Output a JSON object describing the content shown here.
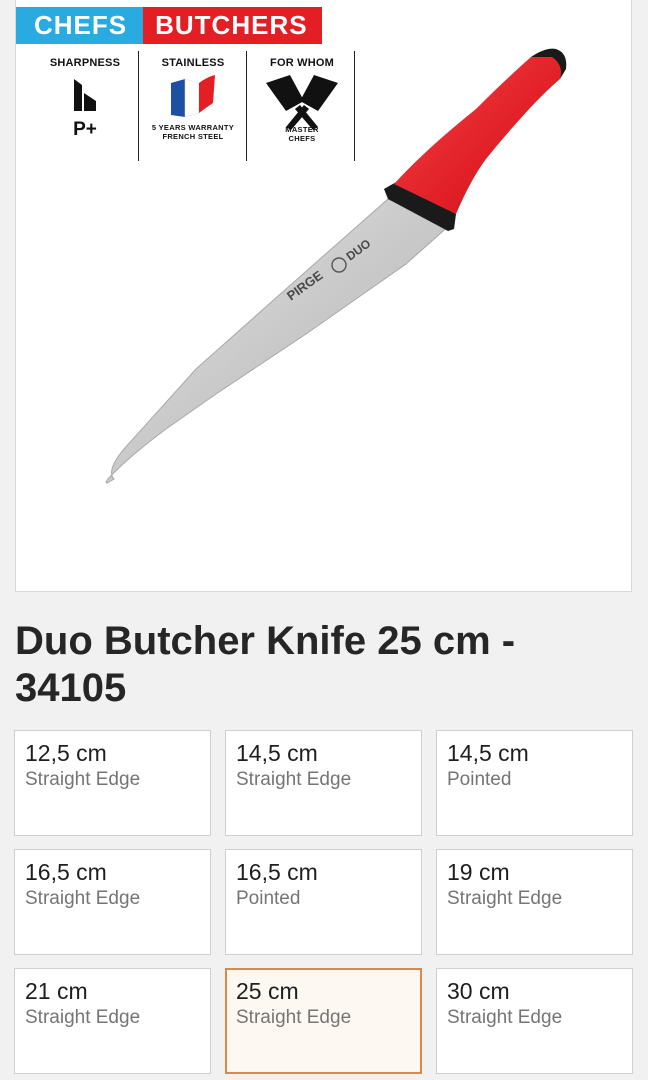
{
  "badges": {
    "chefs": "CHEFS",
    "butchers": "BUTCHERS"
  },
  "specs": {
    "sharpness": {
      "heading": "SHARPNESS",
      "rating": "P+",
      "icon": "sharpness-bars-icon"
    },
    "stainless": {
      "heading": "STAINLESS",
      "warranty_line1": "5 YEARS WARRANTY",
      "warranty_line2": "FRENCH STEEL",
      "icon": "french-flag-icon"
    },
    "for_whom": {
      "heading": "FOR WHOM",
      "audience_line1": "MASTER",
      "audience_line2": "CHEFS",
      "icon": "crossed-cleavers-icon"
    }
  },
  "knife": {
    "brand": "PIRGE",
    "series": "DUO",
    "handle_color": "#e11f26"
  },
  "product": {
    "title": "Duo Butcher Knife 25 cm - 34105"
  },
  "variants": [
    {
      "size": "12,5 cm",
      "type": "Straight Edge",
      "selected": false
    },
    {
      "size": "14,5 cm",
      "type": "Straight Edge",
      "selected": false
    },
    {
      "size": "14,5 cm",
      "type": "Pointed",
      "selected": false
    },
    {
      "size": "16,5 cm",
      "type": "Straight Edge",
      "selected": false
    },
    {
      "size": "16,5 cm",
      "type": "Pointed",
      "selected": false
    },
    {
      "size": "19 cm",
      "type": "Straight Edge",
      "selected": false
    },
    {
      "size": "21 cm",
      "type": "Straight Edge",
      "selected": false
    },
    {
      "size": "25 cm",
      "type": "Straight Edge",
      "selected": true
    },
    {
      "size": "30 cm",
      "type": "Straight Edge",
      "selected": false
    }
  ],
  "colors": {
    "chefs_badge": "#29aae1",
    "butchers_badge": "#e31e24",
    "selected_border": "#d98a48"
  }
}
